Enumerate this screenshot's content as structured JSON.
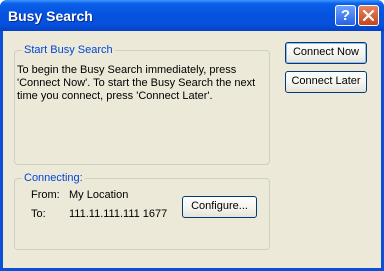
{
  "window": {
    "title": "Busy Search"
  },
  "title_buttons": {
    "help_icon": "?",
    "close_icon": "close-x"
  },
  "start_group": {
    "label": "Start Busy Search",
    "description": "To begin the Busy Search immediately, press\n'Connect Now'.  To start the Busy Search the next\ntime you connect, press 'Connect Later'."
  },
  "buttons": {
    "connect_now": "Connect Now",
    "connect_later": "Connect Later",
    "configure": "Configure..."
  },
  "connecting_group": {
    "label": "Connecting:",
    "from_label": "From:",
    "from_value": "My Location",
    "to_label": "To:",
    "to_value": "111.11.111.111 1677"
  },
  "colors": {
    "titlebar": "#0553e0",
    "group_label": "#0046d5",
    "dialog_bg": "#ece9d8"
  }
}
